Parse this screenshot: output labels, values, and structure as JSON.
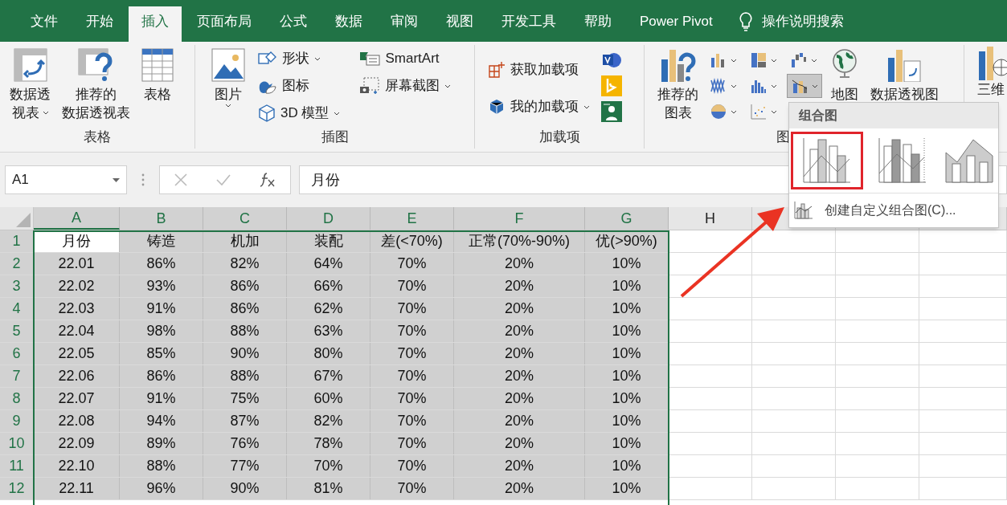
{
  "tabs": [
    {
      "label": "文件",
      "selected": false
    },
    {
      "label": "开始",
      "selected": false
    },
    {
      "label": "插入",
      "selected": true
    },
    {
      "label": "页面布局",
      "selected": false
    },
    {
      "label": "公式",
      "selected": false
    },
    {
      "label": "数据",
      "selected": false
    },
    {
      "label": "审阅",
      "selected": false
    },
    {
      "label": "视图",
      "selected": false
    },
    {
      "label": "开发工具",
      "selected": false
    },
    {
      "label": "帮助",
      "selected": false
    },
    {
      "label": "Power Pivot",
      "selected": false
    }
  ],
  "tell_me": "操作说明搜索",
  "ribbon": {
    "table_group": {
      "label": "表格",
      "pivot_table": [
        "数据透",
        "视表"
      ],
      "recommended_pivot": [
        "推荐的",
        "数据透视表"
      ],
      "table": "表格"
    },
    "illustrations_group": {
      "label": "插图",
      "pictures": "图片",
      "shapes": "形状",
      "icons": "图标",
      "models_3d": "3D 模型",
      "smartart": "SmartArt",
      "screenshot": "屏幕截图"
    },
    "addins_group": {
      "label": "加载项",
      "get_addins": "获取加载项",
      "my_addins": "我的加载项"
    },
    "charts_group": {
      "label": "图",
      "recommended_charts": [
        "推荐的",
        "图表"
      ],
      "chart_buttons": [
        {
          "kind": "column",
          "selected": false
        },
        {
          "kind": "hierarchy",
          "selected": false
        },
        {
          "kind": "waterfall",
          "selected": false
        },
        {
          "kind": "line",
          "selected": false
        },
        {
          "kind": "statistic",
          "selected": false
        },
        {
          "kind": "combo",
          "selected": true
        },
        {
          "kind": "pie",
          "selected": false
        },
        {
          "kind": "scatter",
          "selected": false
        }
      ],
      "maps": "地图",
      "pivot_chart": "数据透视图"
    },
    "map3d_label": "三维"
  },
  "formula_bar": {
    "name_box": "A1",
    "formula": "月份"
  },
  "sheet": {
    "columns": [
      {
        "label": "A",
        "selected": true,
        "active": true
      },
      {
        "label": "B",
        "selected": true,
        "active": false
      },
      {
        "label": "C",
        "selected": true,
        "active": false
      },
      {
        "label": "D",
        "selected": true,
        "active": false
      },
      {
        "label": "E",
        "selected": true,
        "active": false
      },
      {
        "label": "F",
        "selected": true,
        "active": false
      },
      {
        "label": "G",
        "selected": true,
        "active": false
      },
      {
        "label": "H",
        "selected": false,
        "active": false
      }
    ],
    "rows": [
      {
        "header": "1",
        "selected": true,
        "active": true,
        "cells": [
          "月份",
          "铸造",
          "机加",
          "装配",
          "差(<70%)",
          "正常(70%-90%)",
          "优(>90%)"
        ]
      },
      {
        "header": "2",
        "selected": true,
        "active": false,
        "cells": [
          "22.01",
          "86%",
          "82%",
          "64%",
          "70%",
          "20%",
          "10%"
        ]
      },
      {
        "header": "3",
        "selected": true,
        "active": false,
        "cells": [
          "22.02",
          "93%",
          "86%",
          "66%",
          "70%",
          "20%",
          "10%"
        ]
      },
      {
        "header": "4",
        "selected": true,
        "active": false,
        "cells": [
          "22.03",
          "91%",
          "86%",
          "62%",
          "70%",
          "20%",
          "10%"
        ]
      },
      {
        "header": "5",
        "selected": true,
        "active": false,
        "cells": [
          "22.04",
          "98%",
          "88%",
          "63%",
          "70%",
          "20%",
          "10%"
        ]
      },
      {
        "header": "6",
        "selected": true,
        "active": false,
        "cells": [
          "22.05",
          "85%",
          "90%",
          "80%",
          "70%",
          "20%",
          "10%"
        ]
      },
      {
        "header": "7",
        "selected": true,
        "active": false,
        "cells": [
          "22.06",
          "86%",
          "88%",
          "67%",
          "70%",
          "20%",
          "10%"
        ]
      },
      {
        "header": "8",
        "selected": true,
        "active": false,
        "cells": [
          "22.07",
          "91%",
          "75%",
          "60%",
          "70%",
          "20%",
          "10%"
        ]
      },
      {
        "header": "9",
        "selected": true,
        "active": false,
        "cells": [
          "22.08",
          "94%",
          "87%",
          "82%",
          "70%",
          "20%",
          "10%"
        ]
      },
      {
        "header": "10",
        "selected": true,
        "active": false,
        "cells": [
          "22.09",
          "89%",
          "76%",
          "78%",
          "70%",
          "20%",
          "10%"
        ]
      },
      {
        "header": "11",
        "selected": true,
        "active": false,
        "cells": [
          "22.10",
          "88%",
          "77%",
          "70%",
          "70%",
          "20%",
          "10%"
        ]
      },
      {
        "header": "12",
        "selected": true,
        "active": false,
        "cells": [
          "22.11",
          "96%",
          "90%",
          "81%",
          "70%",
          "20%",
          "10%"
        ]
      }
    ]
  },
  "combo_menu": {
    "title": "组合图",
    "options": [
      {
        "kind": "clustered-line",
        "selected": true
      },
      {
        "kind": "clustered-line-secondary",
        "selected": false
      },
      {
        "kind": "stacked-area",
        "selected": false
      }
    ],
    "custom": "创建自定义组合图(C)..."
  }
}
